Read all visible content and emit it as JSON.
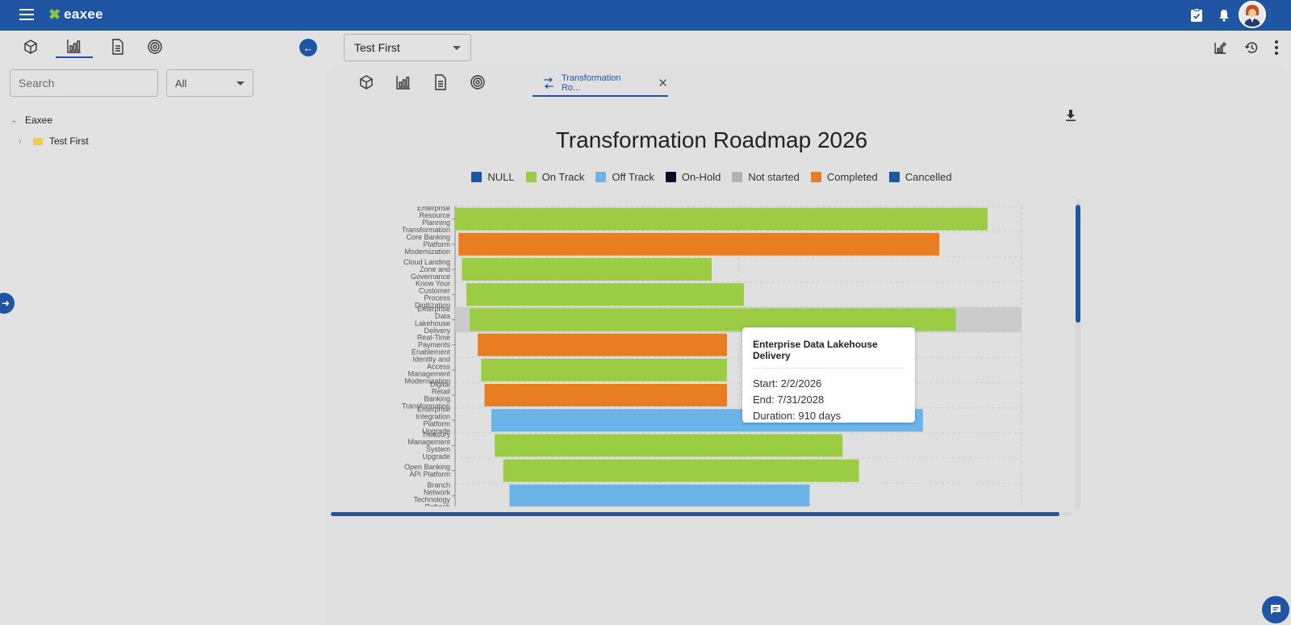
{
  "app": {
    "logo_text": "eaxee"
  },
  "left_panel": {
    "search_placeholder": "Search",
    "filter_value": "All",
    "tree": {
      "root": "Eaxee",
      "child": "Test First"
    }
  },
  "header": {
    "report_select_value": "Test First"
  },
  "tabs": {
    "active_tab_label": "Transformation Ro..."
  },
  "chart_data": {
    "type": "bar",
    "title": "Transformation Roadmap 2026",
    "legend": [
      {
        "name": "NULL",
        "color": "#1f55a3"
      },
      {
        "name": "On Track",
        "color": "#9ccc44"
      },
      {
        "name": "Off Track",
        "color": "#6cb4e8"
      },
      {
        "name": "On-Hold",
        "color": "#0c0c2a"
      },
      {
        "name": "Not started",
        "color": "#b3b3b3"
      },
      {
        "name": "Completed",
        "color": "#e87d21"
      },
      {
        "name": "Cancelled",
        "color": "#1f55a3"
      }
    ],
    "tasks": [
      {
        "name": "Enterprise Resource Planning Transformation",
        "status": "On Track",
        "start": 0.0,
        "end": 0.94
      },
      {
        "name": "Core Banking Platform Modernization",
        "status": "Completed",
        "start": 0.006,
        "end": 0.855
      },
      {
        "name": "Cloud Landing Zone and Governance",
        "status": "On Track",
        "start": 0.012,
        "end": 0.453
      },
      {
        "name": "Know Your Customer Process Digitization",
        "status": "On Track",
        "start": 0.02,
        "end": 0.51
      },
      {
        "name": "Enterprise Data Lakehouse Delivery",
        "status": "On Track",
        "start": 0.026,
        "end": 0.884
      },
      {
        "name": "Real-Time Payments Enablement",
        "status": "Completed",
        "start": 0.04,
        "end": 0.48
      },
      {
        "name": "Identity and Access Management Modernization",
        "status": "On Track",
        "start": 0.046,
        "end": 0.48
      },
      {
        "name": "Digital Retail Banking Transformation",
        "status": "Completed",
        "start": 0.052,
        "end": 0.48
      },
      {
        "name": "Enterprise Integration Platform Upgrade",
        "status": "Off Track",
        "start": 0.064,
        "end": 0.826
      },
      {
        "name": "Treasury Management System Upgrade",
        "status": "On Track",
        "start": 0.07,
        "end": 0.684
      },
      {
        "name": "Open Banking API Platform",
        "status": "On Track",
        "start": 0.085,
        "end": 0.713
      },
      {
        "name": "Branch Network Technology Refresh",
        "status": "Off Track",
        "start": 0.096,
        "end": 0.626
      }
    ],
    "hovered_task": "Enterprise Data Lakehouse Delivery"
  },
  "tooltip": {
    "title": "Enterprise Data Lakehouse Delivery",
    "start": "Start: 2/2/2026",
    "end": "End: 7/31/2028",
    "duration": "Duration: 910 days"
  }
}
